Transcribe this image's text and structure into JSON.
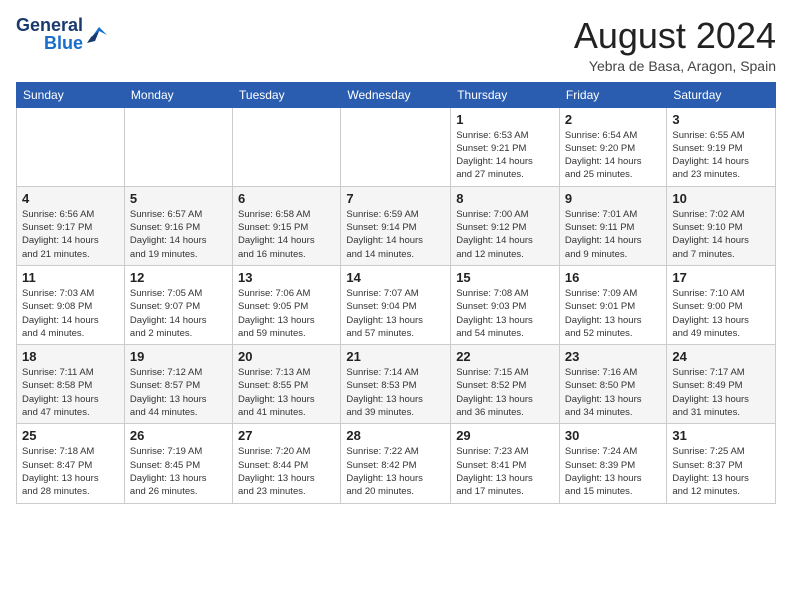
{
  "header": {
    "logo_line1": "General",
    "logo_line2": "Blue",
    "title": "August 2024",
    "subtitle": "Yebra de Basa, Aragon, Spain"
  },
  "weekdays": [
    "Sunday",
    "Monday",
    "Tuesday",
    "Wednesday",
    "Thursday",
    "Friday",
    "Saturday"
  ],
  "weeks": [
    [
      {
        "day": "",
        "info": ""
      },
      {
        "day": "",
        "info": ""
      },
      {
        "day": "",
        "info": ""
      },
      {
        "day": "",
        "info": ""
      },
      {
        "day": "1",
        "info": "Sunrise: 6:53 AM\nSunset: 9:21 PM\nDaylight: 14 hours\nand 27 minutes."
      },
      {
        "day": "2",
        "info": "Sunrise: 6:54 AM\nSunset: 9:20 PM\nDaylight: 14 hours\nand 25 minutes."
      },
      {
        "day": "3",
        "info": "Sunrise: 6:55 AM\nSunset: 9:19 PM\nDaylight: 14 hours\nand 23 minutes."
      }
    ],
    [
      {
        "day": "4",
        "info": "Sunrise: 6:56 AM\nSunset: 9:17 PM\nDaylight: 14 hours\nand 21 minutes."
      },
      {
        "day": "5",
        "info": "Sunrise: 6:57 AM\nSunset: 9:16 PM\nDaylight: 14 hours\nand 19 minutes."
      },
      {
        "day": "6",
        "info": "Sunrise: 6:58 AM\nSunset: 9:15 PM\nDaylight: 14 hours\nand 16 minutes."
      },
      {
        "day": "7",
        "info": "Sunrise: 6:59 AM\nSunset: 9:14 PM\nDaylight: 14 hours\nand 14 minutes."
      },
      {
        "day": "8",
        "info": "Sunrise: 7:00 AM\nSunset: 9:12 PM\nDaylight: 14 hours\nand 12 minutes."
      },
      {
        "day": "9",
        "info": "Sunrise: 7:01 AM\nSunset: 9:11 PM\nDaylight: 14 hours\nand 9 minutes."
      },
      {
        "day": "10",
        "info": "Sunrise: 7:02 AM\nSunset: 9:10 PM\nDaylight: 14 hours\nand 7 minutes."
      }
    ],
    [
      {
        "day": "11",
        "info": "Sunrise: 7:03 AM\nSunset: 9:08 PM\nDaylight: 14 hours\nand 4 minutes."
      },
      {
        "day": "12",
        "info": "Sunrise: 7:05 AM\nSunset: 9:07 PM\nDaylight: 14 hours\nand 2 minutes."
      },
      {
        "day": "13",
        "info": "Sunrise: 7:06 AM\nSunset: 9:05 PM\nDaylight: 13 hours\nand 59 minutes."
      },
      {
        "day": "14",
        "info": "Sunrise: 7:07 AM\nSunset: 9:04 PM\nDaylight: 13 hours\nand 57 minutes."
      },
      {
        "day": "15",
        "info": "Sunrise: 7:08 AM\nSunset: 9:03 PM\nDaylight: 13 hours\nand 54 minutes."
      },
      {
        "day": "16",
        "info": "Sunrise: 7:09 AM\nSunset: 9:01 PM\nDaylight: 13 hours\nand 52 minutes."
      },
      {
        "day": "17",
        "info": "Sunrise: 7:10 AM\nSunset: 9:00 PM\nDaylight: 13 hours\nand 49 minutes."
      }
    ],
    [
      {
        "day": "18",
        "info": "Sunrise: 7:11 AM\nSunset: 8:58 PM\nDaylight: 13 hours\nand 47 minutes."
      },
      {
        "day": "19",
        "info": "Sunrise: 7:12 AM\nSunset: 8:57 PM\nDaylight: 13 hours\nand 44 minutes."
      },
      {
        "day": "20",
        "info": "Sunrise: 7:13 AM\nSunset: 8:55 PM\nDaylight: 13 hours\nand 41 minutes."
      },
      {
        "day": "21",
        "info": "Sunrise: 7:14 AM\nSunset: 8:53 PM\nDaylight: 13 hours\nand 39 minutes."
      },
      {
        "day": "22",
        "info": "Sunrise: 7:15 AM\nSunset: 8:52 PM\nDaylight: 13 hours\nand 36 minutes."
      },
      {
        "day": "23",
        "info": "Sunrise: 7:16 AM\nSunset: 8:50 PM\nDaylight: 13 hours\nand 34 minutes."
      },
      {
        "day": "24",
        "info": "Sunrise: 7:17 AM\nSunset: 8:49 PM\nDaylight: 13 hours\nand 31 minutes."
      }
    ],
    [
      {
        "day": "25",
        "info": "Sunrise: 7:18 AM\nSunset: 8:47 PM\nDaylight: 13 hours\nand 28 minutes."
      },
      {
        "day": "26",
        "info": "Sunrise: 7:19 AM\nSunset: 8:45 PM\nDaylight: 13 hours\nand 26 minutes."
      },
      {
        "day": "27",
        "info": "Sunrise: 7:20 AM\nSunset: 8:44 PM\nDaylight: 13 hours\nand 23 minutes."
      },
      {
        "day": "28",
        "info": "Sunrise: 7:22 AM\nSunset: 8:42 PM\nDaylight: 13 hours\nand 20 minutes."
      },
      {
        "day": "29",
        "info": "Sunrise: 7:23 AM\nSunset: 8:41 PM\nDaylight: 13 hours\nand 17 minutes."
      },
      {
        "day": "30",
        "info": "Sunrise: 7:24 AM\nSunset: 8:39 PM\nDaylight: 13 hours\nand 15 minutes."
      },
      {
        "day": "31",
        "info": "Sunrise: 7:25 AM\nSunset: 8:37 PM\nDaylight: 13 hours\nand 12 minutes."
      }
    ]
  ]
}
